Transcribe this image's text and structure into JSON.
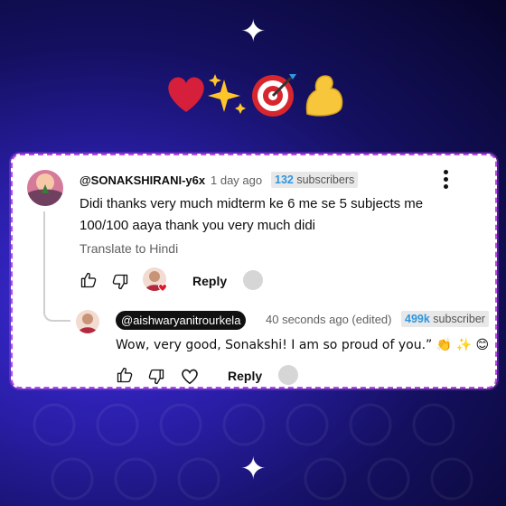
{
  "comment": {
    "handle": "@SONAKSHIRANI-y6x",
    "time": "1 day ago",
    "sub_count": "132",
    "sub_label": "subscribers",
    "text_line1": "Didi thanks very much midterm ke 6 me se 5 subjects me",
    "text_line2": "100/100 aaya thank you very much didi",
    "translate_label": "Translate to Hindi",
    "reply_label": "Reply"
  },
  "reply": {
    "handle": "@aishwaryanitrourkela",
    "time": "40 seconds ago (edited)",
    "sub_count": "499k",
    "sub_label": "subscriber",
    "text": "Wow, very good, Sonakshi! I am so proud of you.” 👏 ✨ 😊",
    "reply_label": "Reply"
  },
  "header_emojis": "❤️✨🎯💪",
  "colors": {
    "card_border": "#b64be8",
    "subscriber_count": "#2f95e0",
    "background": "#2a1ea8",
    "heart": "#d61f3a"
  }
}
